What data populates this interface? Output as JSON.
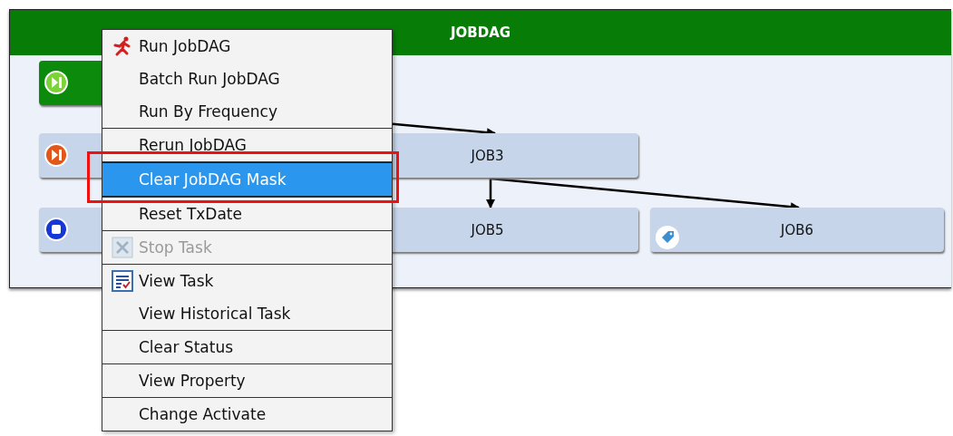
{
  "window": {
    "title": "JOBDAG"
  },
  "nodes": [
    {
      "kind": "running"
    },
    {
      "kind": "skipped"
    },
    {
      "label": "JOB3",
      "kind": "plain"
    },
    {
      "kind": "stopped"
    },
    {
      "label": "JOB5",
      "kind": "plain"
    },
    {
      "label": "JOB6",
      "kind": "tagged"
    }
  ],
  "context_menu": {
    "groups": [
      [
        {
          "label": "Run JobDAG",
          "kind": "run",
          "selected": false,
          "disabled": false
        },
        {
          "label": "Batch Run JobDAG",
          "kind": "plain",
          "selected": false,
          "disabled": false
        },
        {
          "label": "Run By Frequency",
          "kind": "plain",
          "selected": false,
          "disabled": false
        }
      ],
      [
        {
          "label": "Rerun JobDAG",
          "kind": "plain",
          "selected": false,
          "disabled": false
        }
      ],
      [
        {
          "label": "Clear JobDAG Mask",
          "kind": "plain",
          "selected": true,
          "disabled": false
        }
      ],
      [
        {
          "label": "Reset TxDate",
          "kind": "plain",
          "selected": false,
          "disabled": false
        }
      ],
      [
        {
          "label": "Stop Task",
          "kind": "stop",
          "selected": false,
          "disabled": true
        }
      ],
      [
        {
          "label": "View Task",
          "kind": "view",
          "selected": false,
          "disabled": false
        },
        {
          "label": "View Historical Task",
          "kind": "plain",
          "selected": false,
          "disabled": false
        }
      ],
      [
        {
          "label": "Clear Status",
          "kind": "plain",
          "selected": false,
          "disabled": false
        }
      ],
      [
        {
          "label": "View Property",
          "kind": "plain",
          "selected": false,
          "disabled": false
        }
      ],
      [
        {
          "label": "Change Activate",
          "kind": "plain",
          "selected": false,
          "disabled": false
        }
      ]
    ]
  }
}
